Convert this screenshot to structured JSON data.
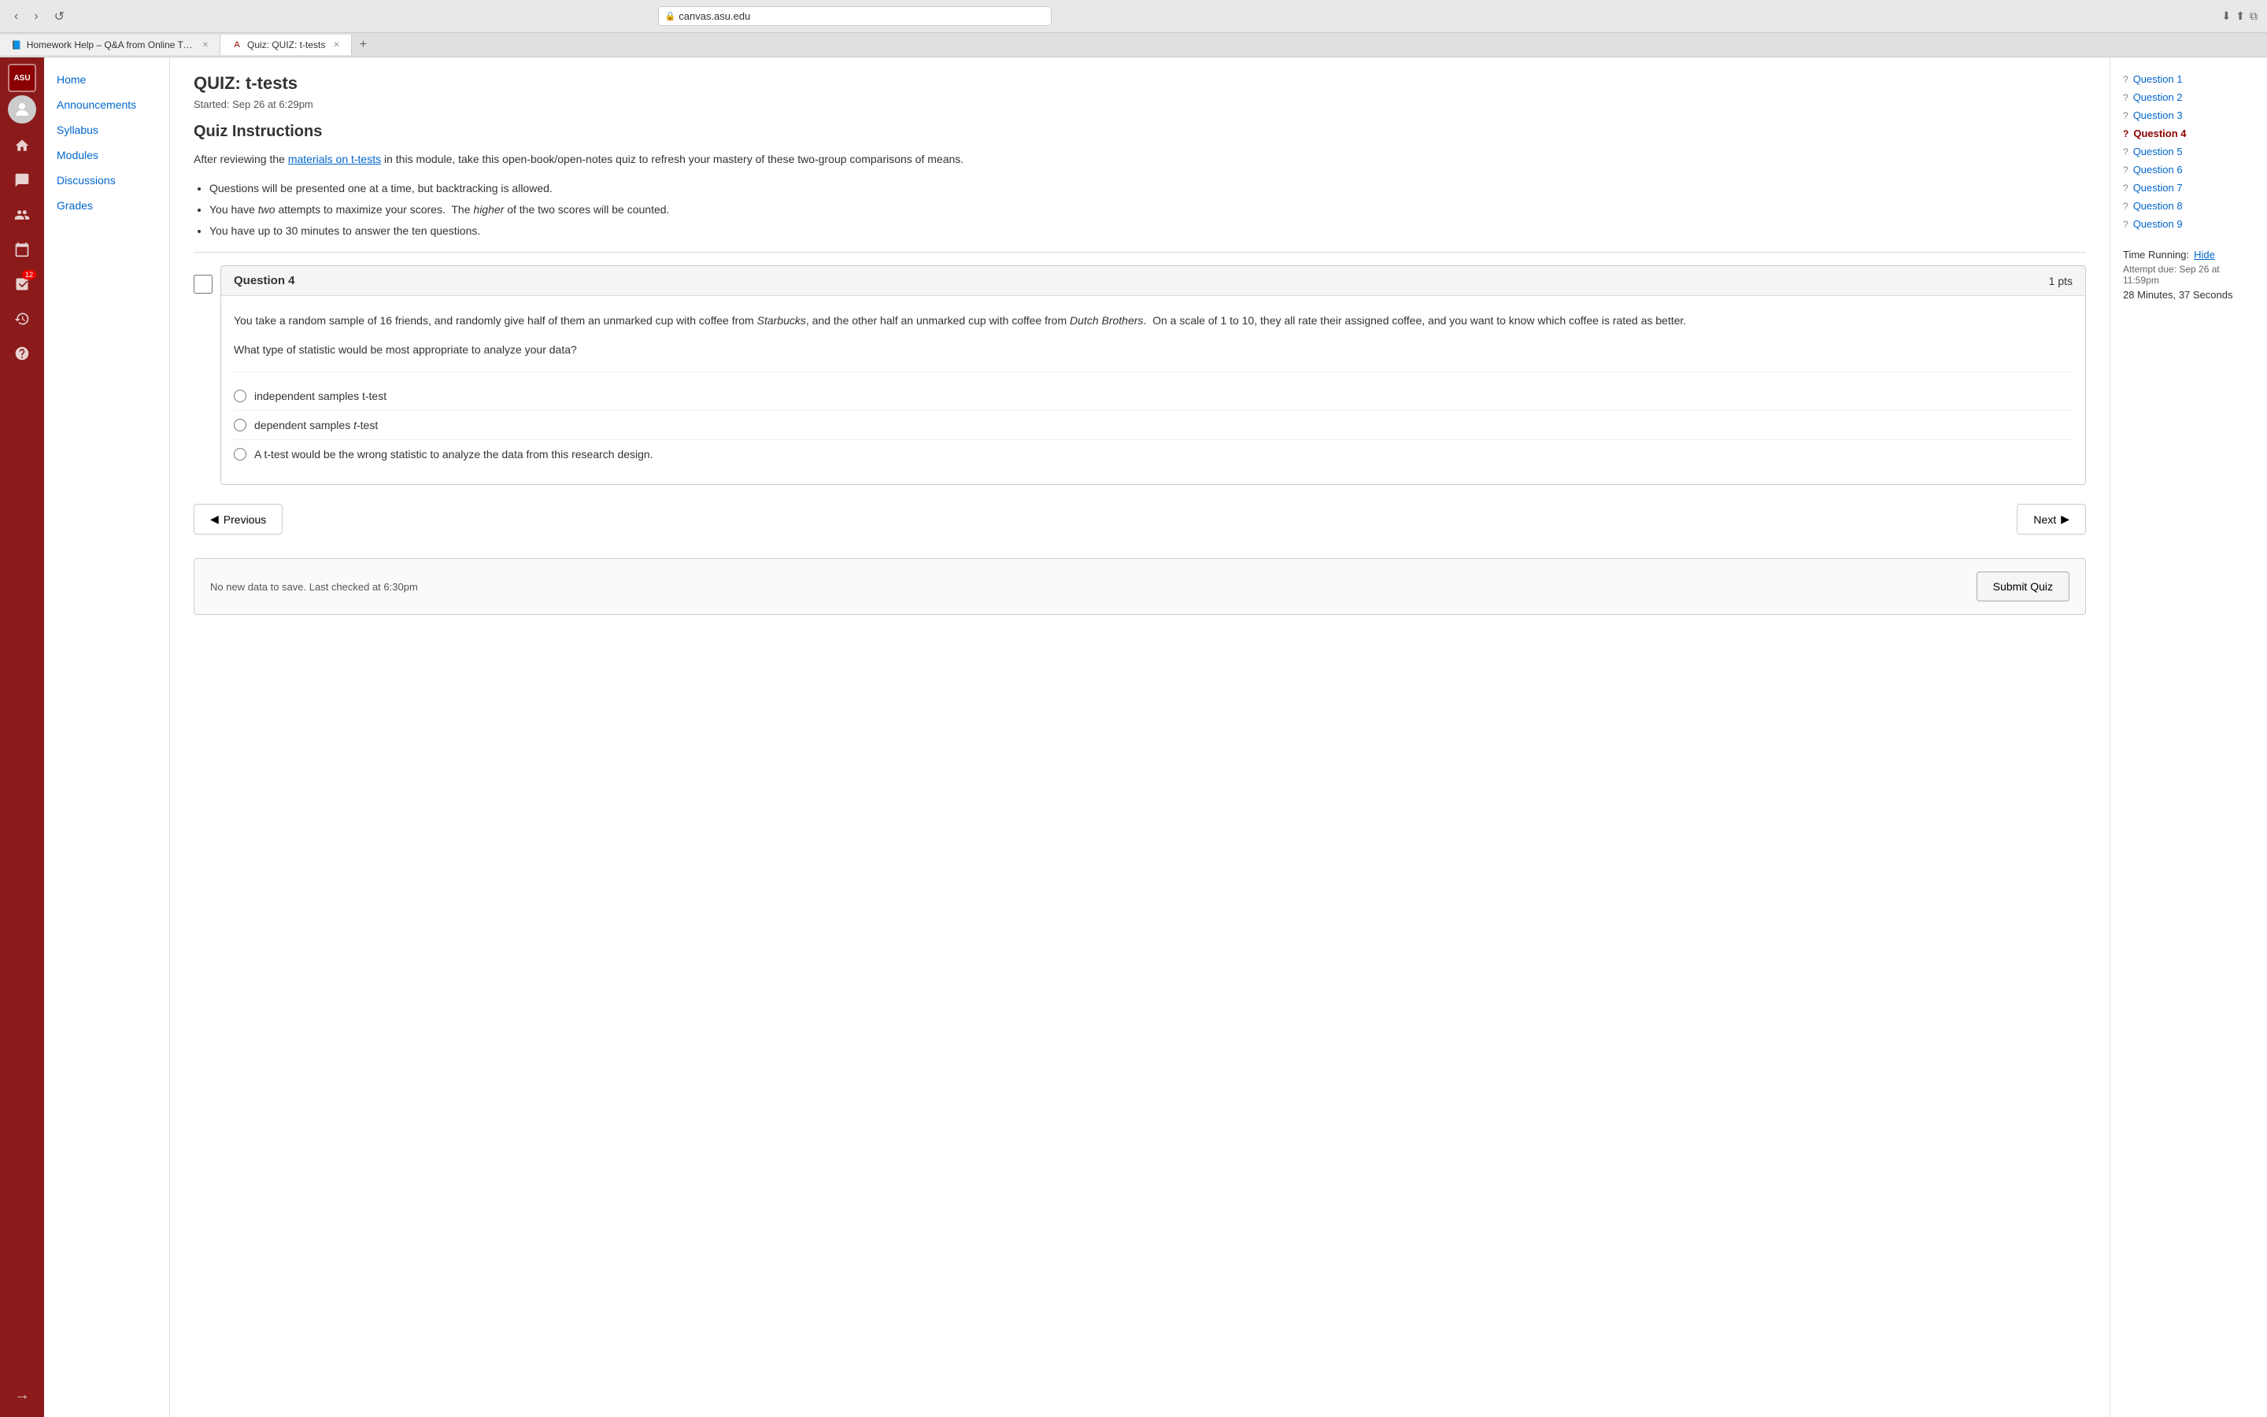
{
  "browser": {
    "back_btn": "‹",
    "forward_btn": "›",
    "tab_icon": "🛡",
    "address": "canvas.asu.edu",
    "reload": "↺",
    "tab1_title": "Homework Help – Q&A from Online Tutors – Course Hero",
    "tab2_title": "Quiz: QUIZ: t-tests",
    "add_tab": "+"
  },
  "icon_nav": {
    "asu_label": "ASU",
    "home_icon": "⌂",
    "announcements_icon": "📋",
    "modules_icon": "☰",
    "people_icon": "👤",
    "calendar_icon": "📅",
    "badge_count": "12",
    "grades_icon": "📊",
    "history_icon": "🕐",
    "help_icon": "?",
    "collapse_icon": "→"
  },
  "sidebar": {
    "items": [
      {
        "label": "Home",
        "href": true
      },
      {
        "label": "Announcements",
        "href": true
      },
      {
        "label": "Syllabus",
        "href": true
      },
      {
        "label": "Modules",
        "href": true
      },
      {
        "label": "Discussions",
        "href": true
      },
      {
        "label": "Grades",
        "href": true
      }
    ]
  },
  "quiz": {
    "title": "QUIZ: t-tests",
    "started": "Started: Sep 26 at 6:29pm",
    "instructions_title": "Quiz Instructions",
    "instructions_text_1": "After reviewing the",
    "instructions_link": "materials on t-tests",
    "instructions_text_2": "in this module, take this open-book/open-notes quiz to refresh your mastery of these two-group comparisons of means.",
    "bullets": [
      "Questions will be presented one at a time, but backtracking is allowed.",
      "You have two attempts to maximize your scores.  The higher of the two scores will be counted.",
      "You have up to 30 minutes to answer the ten questions."
    ],
    "question": {
      "number": "Question 4",
      "points": "1 pts",
      "body": "You take a random sample of 16 friends, and randomly give half of them an unmarked cup with coffee from Starbucks, and the other half an unmarked cup with coffee from Dutch Brothers.  On a scale of 1 to 10, they all rate their assigned coffee, and you want to know which coffee is rated as better.",
      "prompt": "What type of statistic would be most appropriate to analyze your data?",
      "options": [
        {
          "id": "opt1",
          "label": "independent samples t-test"
        },
        {
          "id": "opt2",
          "label": "dependent samples t-test"
        },
        {
          "id": "opt3",
          "label": "A t-test would be the wrong statistic to analyze the data from this research design."
        }
      ]
    },
    "prev_btn": "◀ Previous",
    "next_btn": "Next ▶",
    "submit_status": "No new data to save. Last checked at 6:30pm",
    "submit_btn": "Submit Quiz"
  },
  "right_sidebar": {
    "questions": [
      {
        "label": "Question 1",
        "active": false
      },
      {
        "label": "Question 2",
        "active": false
      },
      {
        "label": "Question 3",
        "active": false
      },
      {
        "label": "Question 4",
        "active": true
      },
      {
        "label": "Question 5",
        "active": false
      },
      {
        "label": "Question 6",
        "active": false
      },
      {
        "label": "Question 7",
        "active": false
      },
      {
        "label": "Question 8",
        "active": false
      },
      {
        "label": "Question 9",
        "active": false
      }
    ],
    "time_running_label": "Time Running:",
    "hide_link": "Hide",
    "attempt_due": "Attempt due: Sep 26 at 11:59pm",
    "time_elapsed": "28 Minutes, 37 Seconds"
  }
}
